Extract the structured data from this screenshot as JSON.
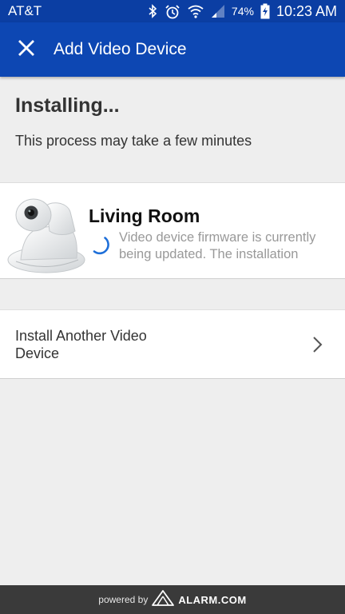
{
  "status_bar": {
    "carrier": "AT&T",
    "battery_percent": "74%",
    "time": "10:23 AM",
    "icons": [
      "bluetooth-icon",
      "alarm-clock-icon",
      "wifi-icon",
      "cell-signal-icon",
      "battery-charging-icon"
    ]
  },
  "app_bar": {
    "title": "Add Video Device",
    "close_icon": "close-icon",
    "color": "#0d47b3"
  },
  "heading": {
    "title": "Installing...",
    "subtitle": "This process may take a few minutes"
  },
  "device": {
    "name": "Living Room",
    "status_text": "Video device firmware is currently being updated. The installation",
    "image": "camera-image",
    "spinner_color": "#1e6fd9"
  },
  "install_another": {
    "label": "Install Another Video Device",
    "icon": "chevron-right-icon"
  },
  "footer": {
    "powered_by": "powered by",
    "brand": "ALARM.COM"
  }
}
